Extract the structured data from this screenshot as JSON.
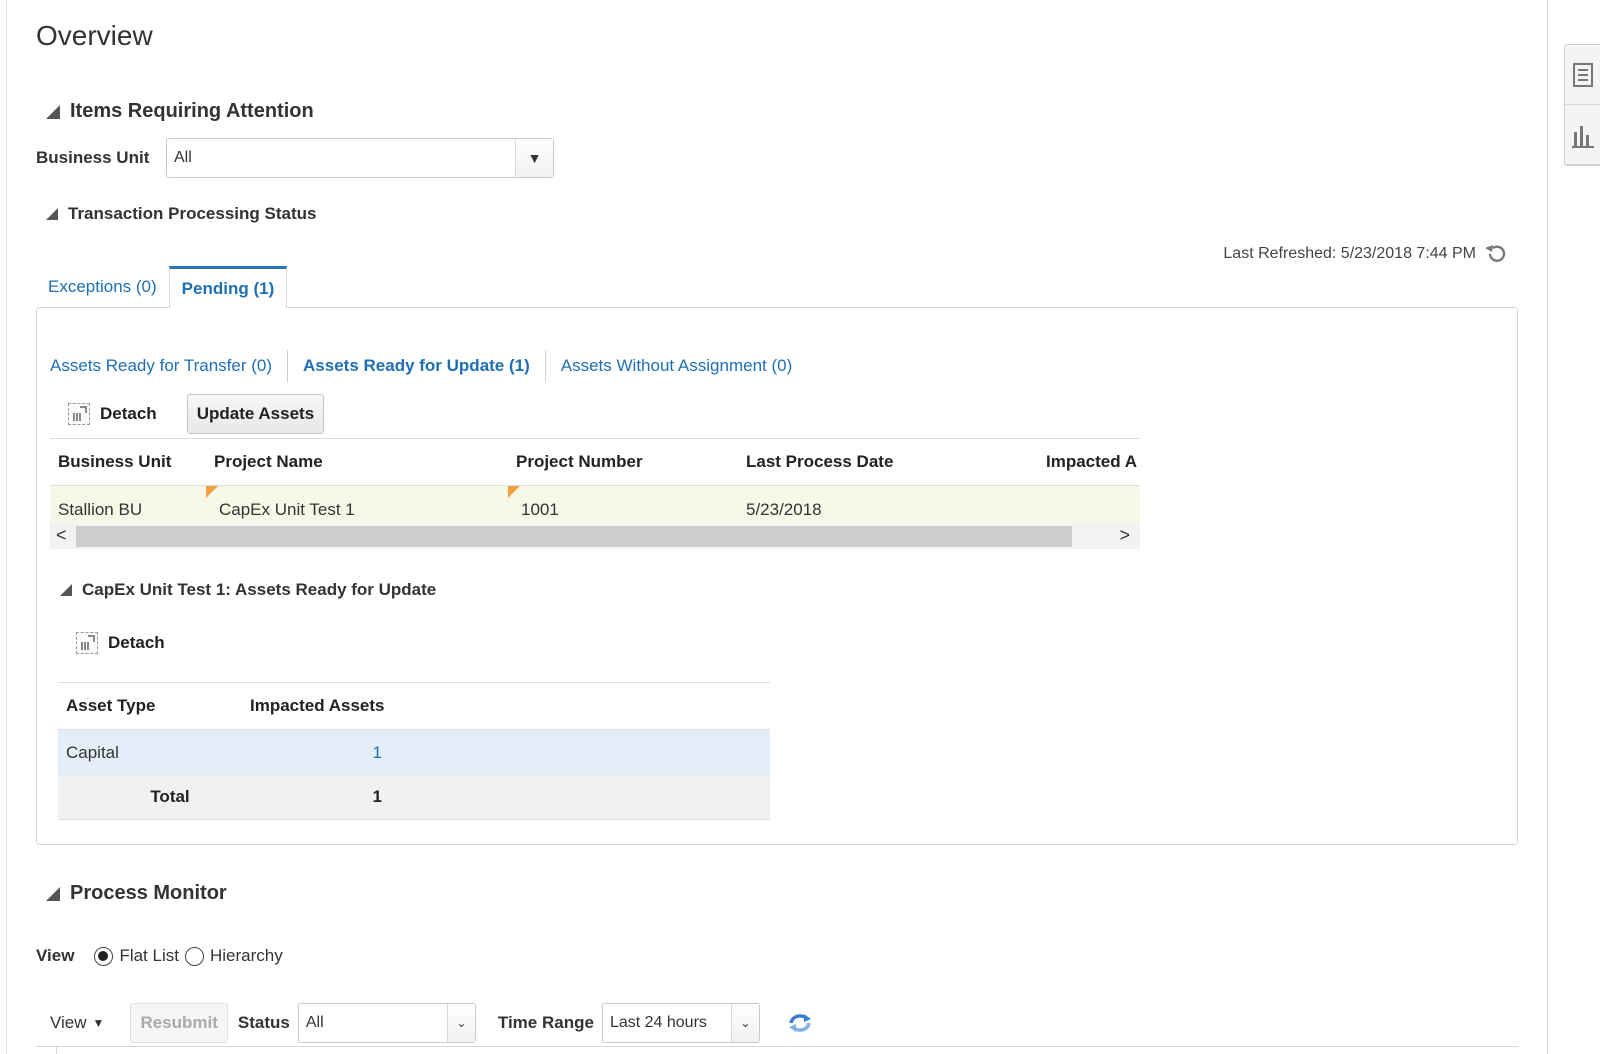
{
  "page": {
    "title": "Overview"
  },
  "attention": {
    "heading": "Items Requiring Attention",
    "business_unit_label": "Business Unit",
    "business_unit_value": "All"
  },
  "tps": {
    "heading": "Transaction Processing Status",
    "last_refreshed": "Last Refreshed: 5/23/2018 7:44 PM",
    "tabs": [
      {
        "label": "Exceptions (0)",
        "active": false
      },
      {
        "label": "Pending (1)",
        "active": true
      }
    ],
    "subtabs": [
      {
        "label": "Assets Ready for Transfer (0)",
        "active": false
      },
      {
        "label": "Assets Ready for Update (1)",
        "active": true
      },
      {
        "label": "Assets Without Assignment (0)",
        "active": false
      }
    ],
    "toolbar": {
      "detach_label": "Detach",
      "update_label": "Update Assets"
    },
    "table": {
      "columns": [
        "Business Unit",
        "Project Name",
        "Project Number",
        "Last Process Date",
        "Impacted A"
      ],
      "rows": [
        [
          "Stallion BU",
          "CapEx Unit Test 1",
          "1001",
          "5/23/2018",
          ""
        ]
      ]
    }
  },
  "detail": {
    "heading": "CapEx Unit Test 1: Assets Ready for Update",
    "detach_label": "Detach",
    "columns": [
      "Asset Type",
      "Impacted Assets"
    ],
    "rows": [
      [
        "Capital",
        "1"
      ]
    ],
    "total_label": "Total",
    "total_value": "1"
  },
  "process_monitor": {
    "heading": "Process Monitor",
    "view_label": "View",
    "view_options": [
      "Flat List",
      "Hierarchy"
    ],
    "view_selected": "Flat List",
    "view_menu_label": "View",
    "resubmit_label": "Resubmit",
    "status_label": "Status",
    "status_value": "All",
    "time_range_label": "Time Range",
    "time_range_value": "Last 24 hours"
  },
  "icons": {
    "collapse": "collapse-triangle-icon",
    "refresh": "refresh-icon",
    "detach": "detach-icon",
    "side_list": "list-icon",
    "side_chart": "bar-chart-icon"
  },
  "colors": {
    "link": "#1f6fb5",
    "tab_accent": "#2a76c5",
    "row_highlight": "#f8f8e8",
    "row_selected": "#e4eef9"
  }
}
